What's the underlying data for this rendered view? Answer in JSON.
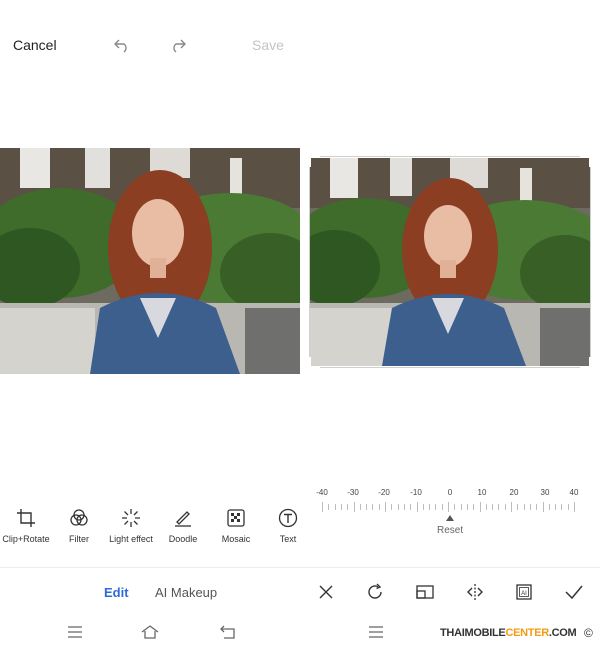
{
  "left": {
    "top_bar": {
      "cancel_label": "Cancel",
      "save_label": "Save"
    },
    "tools": [
      {
        "label": "Clip+Rotate",
        "icon": "crop-rotate-icon"
      },
      {
        "label": "Filter",
        "icon": "filter-icon"
      },
      {
        "label": "Light effect",
        "icon": "light-effect-icon"
      },
      {
        "label": "Doodle",
        "icon": "doodle-icon"
      },
      {
        "label": "Mosaic",
        "icon": "mosaic-icon"
      },
      {
        "label": "Text",
        "icon": "text-icon"
      }
    ],
    "tabs": {
      "edit": "Edit",
      "ai_makeup": "AI Makeup"
    }
  },
  "right": {
    "ruler": {
      "labels": [
        "-40",
        "-30",
        "-20",
        "-10",
        "0",
        "10",
        "20",
        "30",
        "40"
      ],
      "reset_label": "Reset"
    },
    "toolbar_icons": [
      "close-icon",
      "rotate-icon",
      "aspect-ratio-icon",
      "flip-icon",
      "ai-crop-icon",
      "confirm-icon"
    ]
  },
  "watermark": {
    "part1": "THAIMOBILE",
    "part2": "CENTER",
    "part3": ".COM",
    "copyright": "©"
  },
  "colors": {
    "accent_blue": "#2f6bd8",
    "disabled_text": "#c4c4c4",
    "watermark_orange": "#f39c12"
  }
}
